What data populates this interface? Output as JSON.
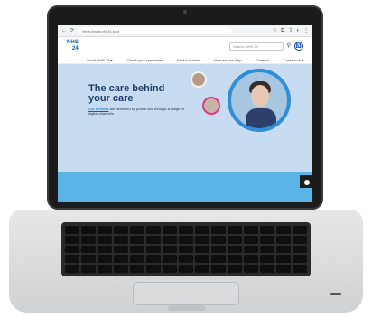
{
  "browser": {
    "url": "https://www.nhs24.scot"
  },
  "header": {
    "logo_main": "NHS",
    "logo_tag": "",
    "logo_num": "24",
    "search_placeholder": "Search NHS 24",
    "search_icon": "search-icon",
    "access_icon": "accessibility-icon"
  },
  "nav": {
    "items": [
      {
        "label": "About NHS 24 ▾"
      },
      {
        "label": "Check your symptoms"
      },
      {
        "label": "Find a service"
      },
      {
        "label": "How we can help"
      },
      {
        "label": "Careers"
      },
      {
        "label": "Contact us ▾"
      }
    ]
  },
  "hero": {
    "line1": "The care behind",
    "line2": "your care",
    "link": "Our services",
    "text_after_link": " are delivered by phone and through a range of digital channels."
  },
  "colors": {
    "brand_blue": "#005eb8",
    "heading_navy": "#1d3d6b",
    "hero_bg": "#c7dcf1",
    "accent_pink": "#e0368c",
    "screen_bg": "#5ab4e6"
  }
}
